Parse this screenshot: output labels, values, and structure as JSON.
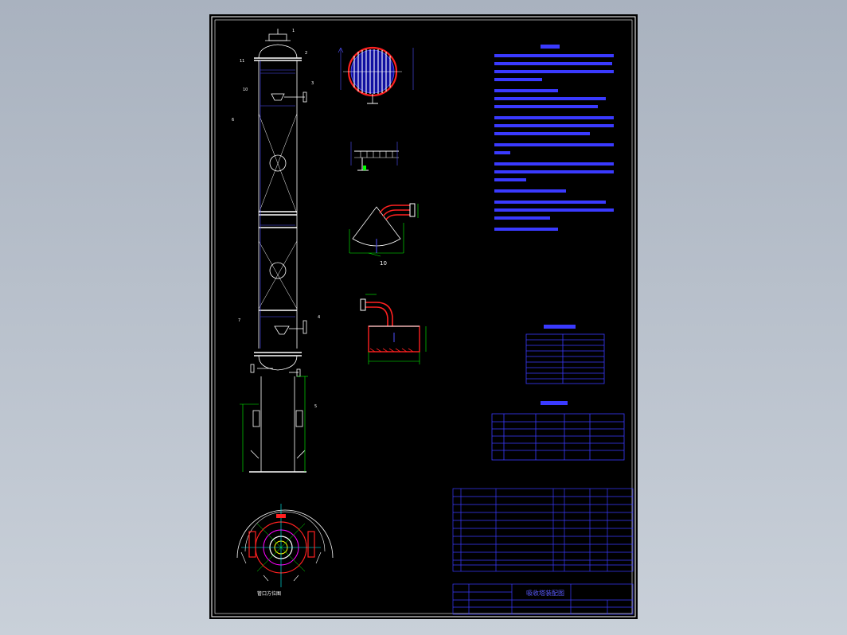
{
  "labels": {
    "title_block_name": "吸收塔装配图",
    "section_view_label": "管口方位图",
    "detail_number": "10"
  },
  "colors": {
    "background_outer": "#b4bcc8",
    "sheet": "#000000",
    "lines": "#ffffff",
    "dimension": "#00ff00",
    "blue": "#0000ff",
    "red": "#ff2020",
    "cyan": "#00ffff",
    "magenta": "#ff00ff"
  }
}
